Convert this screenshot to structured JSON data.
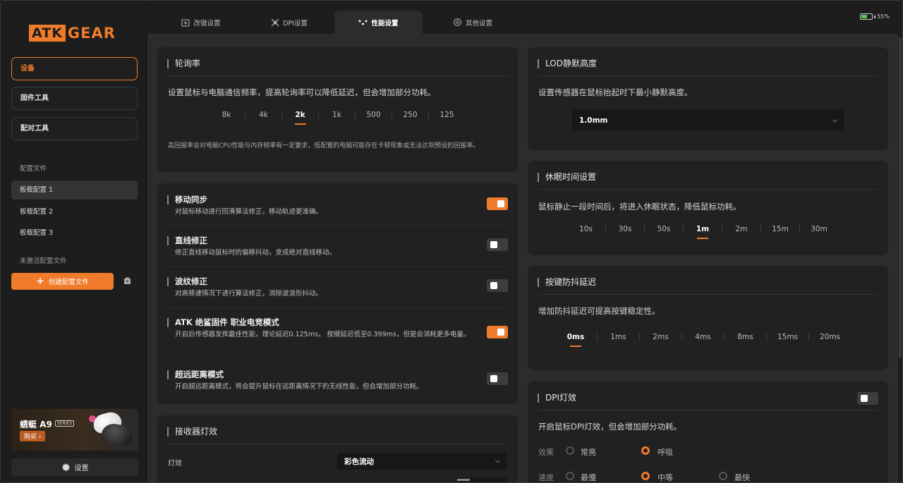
{
  "brand": {
    "atk": "ATK",
    "gear": "GEAR"
  },
  "sidebar": {
    "nav": [
      {
        "label": "设备",
        "active": true
      },
      {
        "label": "固件工具",
        "active": false
      },
      {
        "label": "配对工具",
        "active": false
      }
    ],
    "profiles_heading": "配置文件",
    "profiles": [
      {
        "label": "板载配置 1",
        "active": true
      },
      {
        "label": "板载配置 2",
        "active": false
      },
      {
        "label": "板载配置 3",
        "active": false
      }
    ],
    "inactive_heading": "未激活配置文件",
    "create_button": "创建配置文件",
    "ad": {
      "title": "蜻蜓 A9",
      "series": "SERIES",
      "buy": "购买 ›"
    },
    "settings_label": "设置"
  },
  "tabs": [
    {
      "label": "改键设置",
      "icon": "keybind-icon",
      "active": false
    },
    {
      "label": "DPI设置",
      "icon": "dpi-icon",
      "active": false
    },
    {
      "label": "性能设置",
      "icon": "performance-icon",
      "active": true
    },
    {
      "label": "其他设置",
      "icon": "gear-icon",
      "active": false
    }
  ],
  "battery": {
    "percent_label": "55%",
    "level": 0.55
  },
  "polling": {
    "title": "轮询率",
    "desc": "设置鼠标与电脑通信频率，提高轮询率可以降低延迟，但会增加部分功耗。",
    "options": [
      "8k",
      "4k",
      "2k",
      "1k",
      "500",
      "250",
      "125"
    ],
    "selected": "2k",
    "note": "高回报率会对电脑CPU性能与内存频率有一定要求，低配置的电脑可能存在卡顿现象或无法达到预设的回报率。"
  },
  "toggles": [
    {
      "title": "移动同步",
      "desc": "对鼠标移动进行回滑算法修正，移动轨迹更准确。",
      "on": true
    },
    {
      "title": "直线修正",
      "desc": "修正直线移动鼠标时的偏移抖动，变成绝对直线移动。",
      "on": false
    },
    {
      "title": "波纹修正",
      "desc": "对高移速情况下进行算法修正，消除波浪形抖动。",
      "on": false
    },
    {
      "title": "ATK 绝鲨固件 职业电竞模式",
      "desc": "开启后传感器发挥最佳性能，理论延迟0.125ms， 按键延迟低至0.399ms，但是会消耗更多电量。",
      "on": true
    },
    {
      "title": "超远距离模式",
      "desc": "开启超远距离模式，将会提升鼠标在远距离情况下的无线性能，但会增加部分功耗。",
      "on": false
    }
  ],
  "receiver": {
    "title": "接收器灯效",
    "light_label": "灯效",
    "light_value": "彩色流动"
  },
  "lod": {
    "title": "LOD静默高度",
    "desc": "设置传感器在鼠标抬起时下最小静默高度。",
    "value": "1.0mm"
  },
  "sleep": {
    "title": "休眠时间设置",
    "desc": "鼠标静止一段时间后，将进入休眠状态，降低鼠标功耗。",
    "options": [
      "10s",
      "30s",
      "50s",
      "1m",
      "2m",
      "15m",
      "30m"
    ],
    "selected": "1m"
  },
  "debounce": {
    "title": "按键防抖延迟",
    "desc": "增加防抖延迟可提高按键稳定性。",
    "options": [
      "0ms",
      "1ms",
      "2ms",
      "4ms",
      "8ms",
      "15ms",
      "20ms"
    ],
    "selected": "0ms"
  },
  "dpi_light": {
    "title": "DPI灯效",
    "desc": "开启鼠标DPI灯效，但会增加部分功耗。",
    "on": false,
    "effect_label": "效果",
    "effect_options": [
      "常亮",
      "呼吸"
    ],
    "effect_selected": "呼吸",
    "speed_label": "速度",
    "speed_options": [
      "最慢",
      "中等",
      "最快"
    ],
    "speed_selected": "中等"
  },
  "colors": {
    "accent": "#f07b2b",
    "card": "#212121",
    "panel": "#2c2c2c"
  }
}
